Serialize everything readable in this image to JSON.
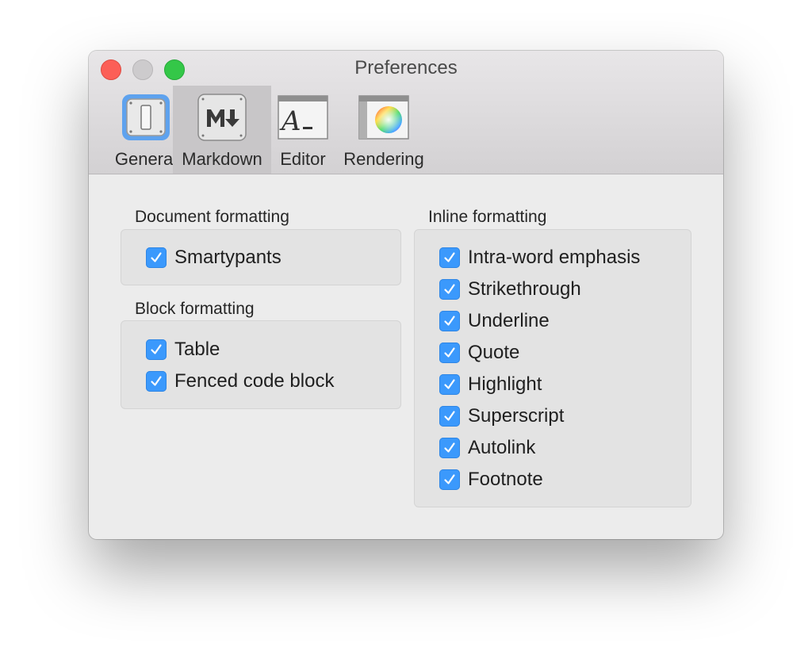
{
  "window": {
    "title": "Preferences"
  },
  "tabs": [
    {
      "label": "General",
      "icon": "switch-icon"
    },
    {
      "label": "Markdown",
      "icon": "markdown-icon",
      "selected": true
    },
    {
      "label": "Editor",
      "icon": "font-icon"
    },
    {
      "label": "Rendering",
      "icon": "color-wheel-icon"
    }
  ],
  "document_formatting": {
    "title": "Document formatting",
    "options": [
      {
        "label": "Smartypants",
        "checked": true
      }
    ]
  },
  "block_formatting": {
    "title": "Block formatting",
    "options": [
      {
        "label": "Table",
        "checked": true
      },
      {
        "label": "Fenced code block",
        "checked": true
      }
    ]
  },
  "inline_formatting": {
    "title": "Inline formatting",
    "options": [
      {
        "label": "Intra-word emphasis",
        "checked": true
      },
      {
        "label": "Strikethrough",
        "checked": true
      },
      {
        "label": "Underline",
        "checked": true
      },
      {
        "label": "Quote",
        "checked": true
      },
      {
        "label": "Highlight",
        "checked": true
      },
      {
        "label": "Superscript",
        "checked": true
      },
      {
        "label": "Autolink",
        "checked": true
      },
      {
        "label": "Footnote",
        "checked": true
      }
    ]
  },
  "colors": {
    "accent": "#3b99fc",
    "close": "#fc5f57",
    "zoom": "#34c748"
  }
}
